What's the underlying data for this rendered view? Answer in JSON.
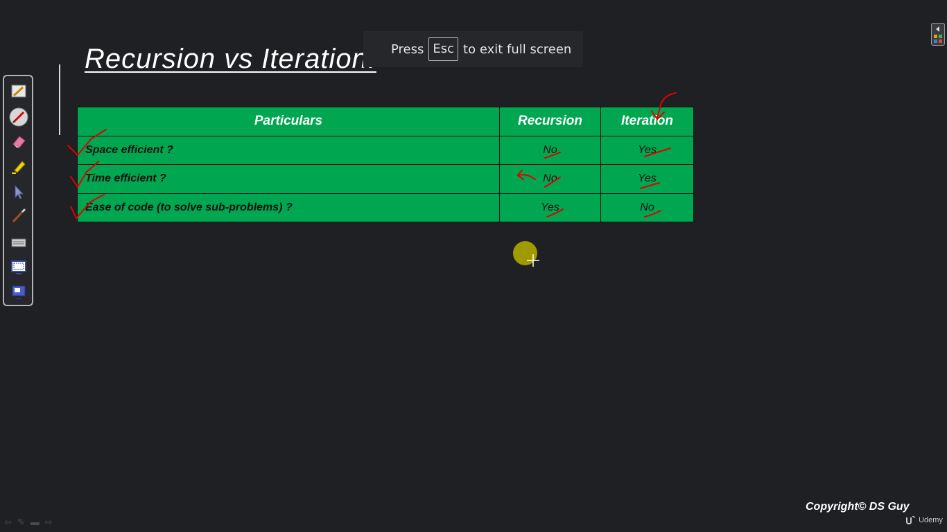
{
  "slide": {
    "title": "Recursion vs Iteration:"
  },
  "fullscreen_banner": {
    "before": "Press",
    "key": "Esc",
    "after": "to exit full screen"
  },
  "table": {
    "headers": [
      "Particulars",
      "Recursion",
      "Iteration"
    ],
    "rows": [
      {
        "particular": "Space efficient ?",
        "recursion": "No",
        "iteration": "Yes"
      },
      {
        "particular": "Time efficient ?",
        "recursion": "No",
        "iteration": "Yes"
      },
      {
        "particular": "Ease of code (to solve sub-problems) ?",
        "recursion": "Yes",
        "iteration": "No"
      }
    ]
  },
  "toolbar": {
    "tools": [
      "pen-select-icon",
      "red-pen-icon",
      "eraser-icon",
      "highlighter-icon",
      "pointer-icon",
      "brush-icon",
      "keyboard-icon",
      "screen-capture-icon",
      "display-icon"
    ]
  },
  "footer": {
    "copyright": "Copyright© DS Guy",
    "watermark": "Udemy"
  },
  "colors": {
    "background": "#1f2023",
    "table_green": "#00a650",
    "annotation_red": "#e00000",
    "cursor_highlight": "#9e9a00"
  }
}
